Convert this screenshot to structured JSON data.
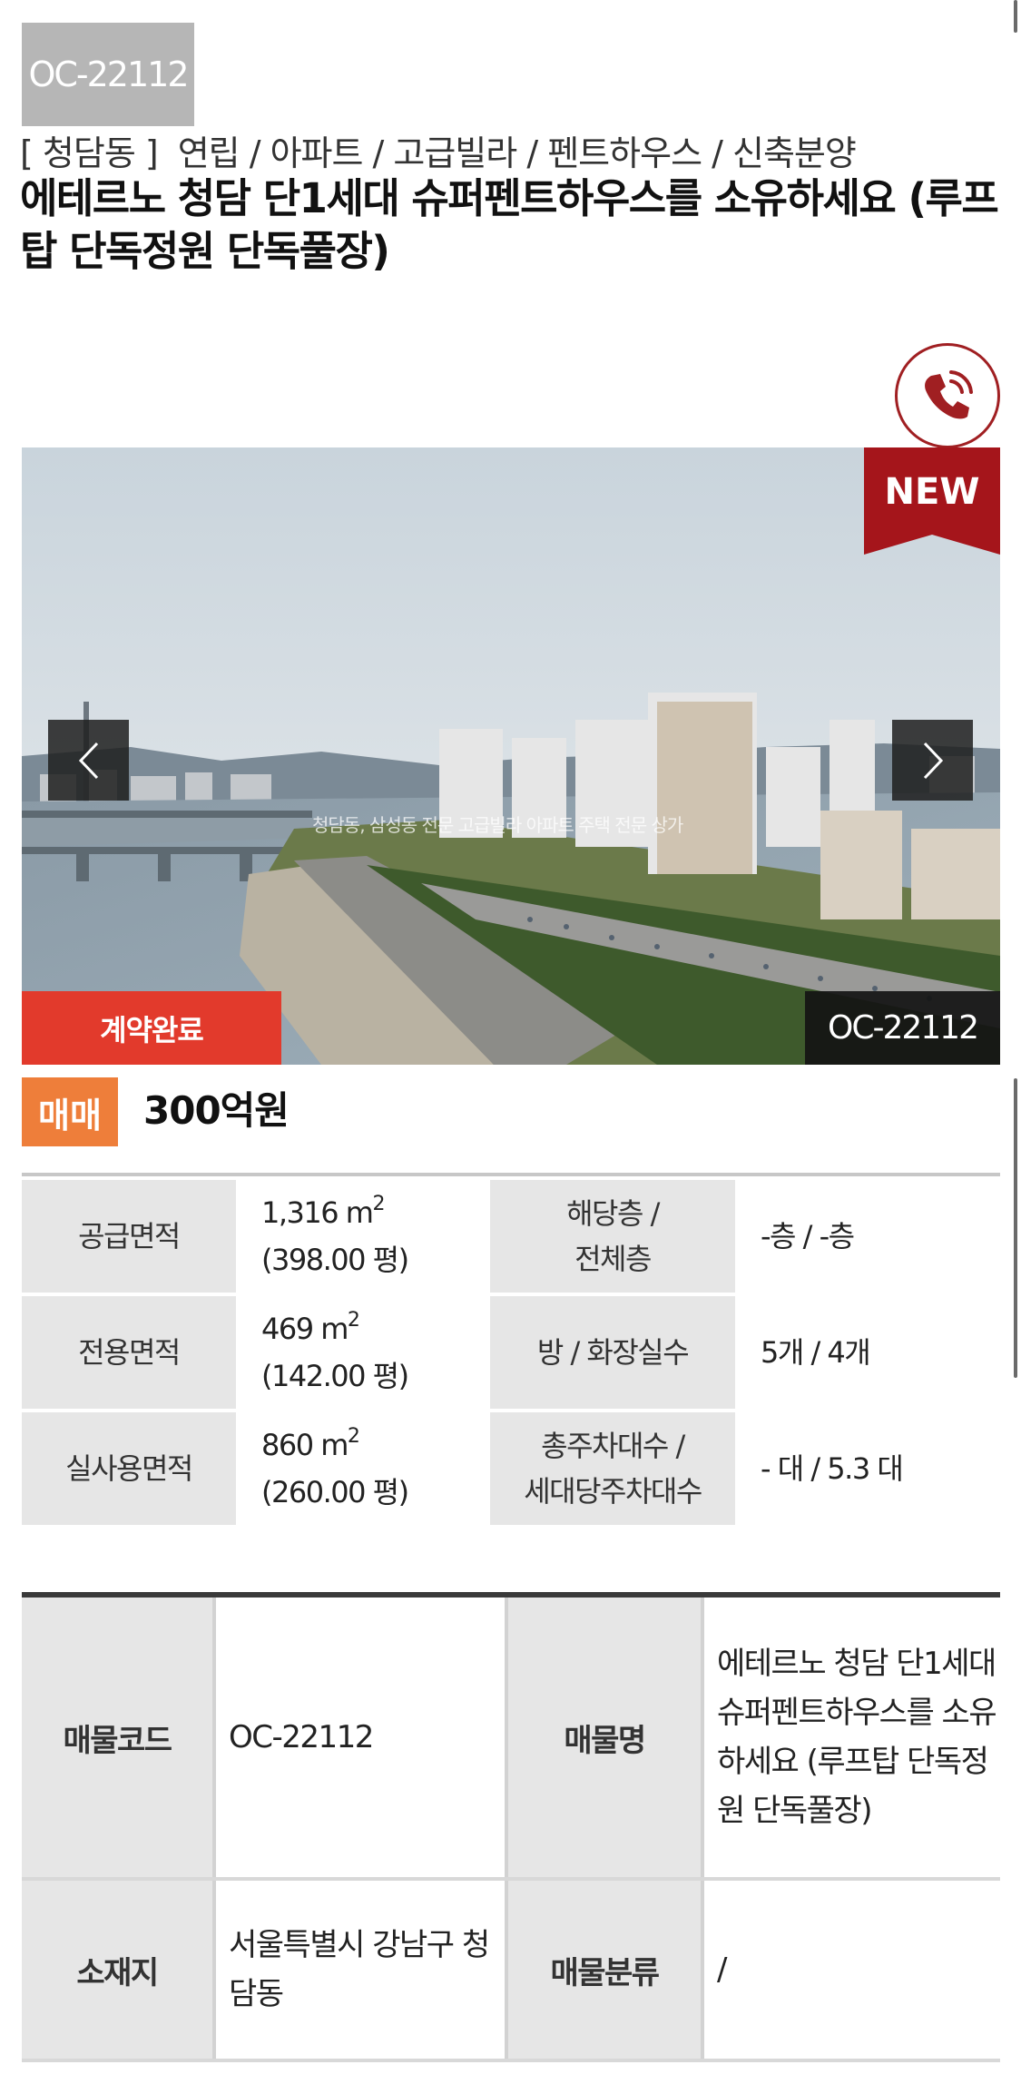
{
  "listing": {
    "code": "OC-22112",
    "region": "[ 청담동 ]",
    "categories": "연립 / 아파트 / 고급빌라 / 펜트하우스 / 신축분양",
    "title": "에테르노 청담 단1세대 슈퍼펜트하우스를 소유하세요 (루프탑 단독정원 단독풀장)",
    "call_icon": "phone-icon"
  },
  "gallery": {
    "new_label": "NEW",
    "status_badge": "계약완료",
    "image_code": "OC-22112",
    "watermark": "청담동, 삼성동 전문 고급빌라 아파트 주택 전문 상가",
    "prev_icon": "chevron-left-icon",
    "next_icon": "chevron-right-icon"
  },
  "deal": {
    "type": "매매",
    "price": "300억원",
    "type_color": "#ee7e3a"
  },
  "specs": [
    {
      "label1": "공급면적",
      "value1_area": "1,316 m",
      "value1_sup": "2",
      "value1_pyeong": "(398.00 평)",
      "label2_line1": "해당층 /",
      "label2_line2": "전체층",
      "value2": "-층 / -층"
    },
    {
      "label1": "전용면적",
      "value1_area": "469 m",
      "value1_sup": "2",
      "value1_pyeong": "(142.00 평)",
      "label2_line1": "방 / 화장실수",
      "label2_line2": "",
      "value2": "5개 / 4개"
    },
    {
      "label1": "실사용면적",
      "value1_area": "860 m",
      "value1_sup": "2",
      "value1_pyeong": "(260.00 평)",
      "label2_line1": "총주차대수 /",
      "label2_line2": "세대당주차대수",
      "value2": "- 대 / 5.3 대"
    }
  ],
  "info": {
    "code_label": "매물코드",
    "code_value": "OC-22112",
    "name_label": "매물명",
    "name_value": "에테르노 청담 단1세대 슈퍼펜트하우스를 소유하세요 (루프탑 단독정원 단독풀장)",
    "location_label": "소재지",
    "location_value": "서울특별시  강남구 청담동",
    "category_label": "매물분류",
    "category_value": "/"
  }
}
